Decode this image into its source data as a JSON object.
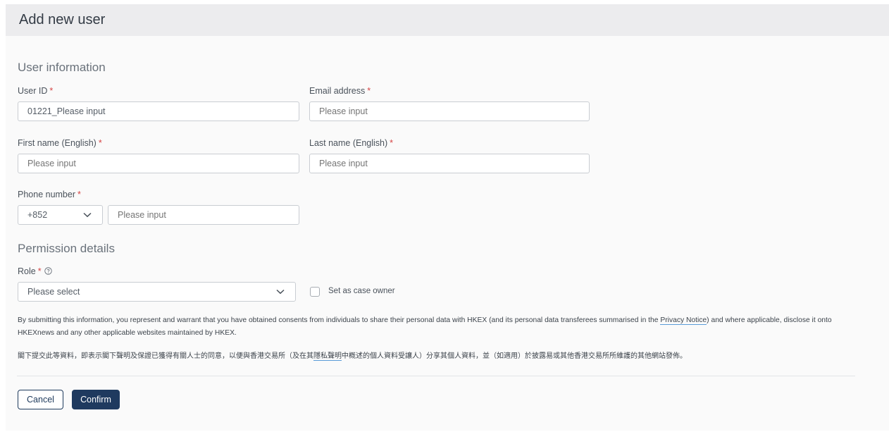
{
  "dialog": {
    "title": "Add new user"
  },
  "user_info": {
    "heading": "User information",
    "user_id": {
      "label": "User ID",
      "value": "01221_Please input"
    },
    "email": {
      "label": "Email address",
      "placeholder": "Please input"
    },
    "first_name": {
      "label": "First name (English)",
      "placeholder": "Please input"
    },
    "last_name": {
      "label": "Last name (English)",
      "placeholder": "Please input"
    },
    "phone": {
      "label": "Phone number",
      "country_code": "+852",
      "placeholder": "Please input"
    },
    "required_mark": "*"
  },
  "permission": {
    "heading": "Permission details",
    "role": {
      "label": "Role",
      "placeholder": "Please select"
    },
    "case_owner": {
      "label": "Set as case owner",
      "checked": false
    }
  },
  "disclaimer": {
    "en_before": "By submitting this information, you represent and warrant that you have obtained consents from individuals to share their personal data with HKEX (and its personal data transferees summarised in the",
    "en_link": "Privacy Notice",
    "en_after": ") and where applicable, disclose it onto HKEXnews and any other applicable websites maintained by HKEX.",
    "zh_before": "閣下提交此等資料，即表示閣下聲明及保證已獲得有關人士的同意，以便與香港交易所（及在其",
    "zh_link": "隱私聲明",
    "zh_after": "中概述的個人資料受讓人）分享其個人資料，並（如適用）於披露易或其他香港交易所所維護的其他網站發佈。"
  },
  "actions": {
    "cancel_label": "Cancel",
    "confirm_label": "Confirm"
  },
  "colors": {
    "primary": "#1f3a5f",
    "required": "#d64545",
    "link_underline": "#5a9cd8",
    "header_bg": "#ececee"
  }
}
